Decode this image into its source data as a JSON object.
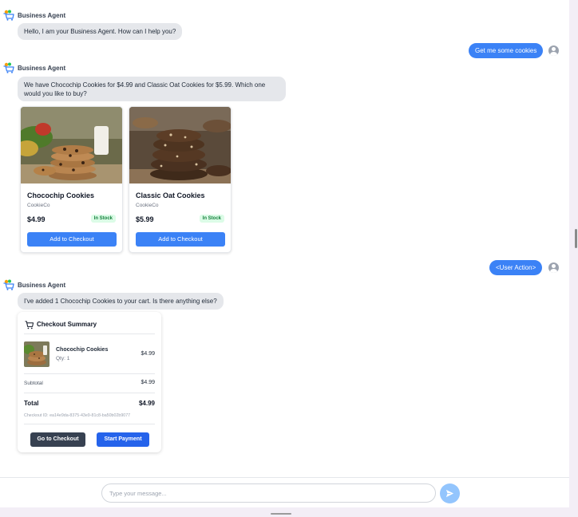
{
  "agent_name": "Business Agent",
  "messages": {
    "greeting": "Hello, I am your Business Agent. How can I help you?",
    "user_request": "Get me some cookies",
    "offer": "We have Chocochip Cookies for $4.99 and Classic Oat Cookies for $5.99. Which one would you like to buy?",
    "user_action": "<User Action>",
    "confirmation": "I've added 1 Chocochip Cookies to your cart. Is there anything else?"
  },
  "products": [
    {
      "name": "Chocochip Cookies",
      "brand": "CookieCo",
      "price": "$4.99",
      "stock": "In Stock",
      "button": "Add to Checkout"
    },
    {
      "name": "Classic Oat Cookies",
      "brand": "CookieCo",
      "price": "$5.99",
      "stock": "In Stock",
      "button": "Add to Checkout"
    }
  ],
  "checkout": {
    "title": "Checkout Summary",
    "item_name": "Chocochip Cookies",
    "item_qty": "Qty: 1",
    "item_price": "$4.99",
    "subtotal_label": "Subtotal",
    "subtotal_value": "$4.99",
    "total_label": "Total",
    "total_value": "$4.99",
    "checkout_id": "Checkout ID: ea14e9da-8375-43e9-81c8-ba50b02b9077",
    "go_button": "Go to Checkout",
    "pay_button": "Start Payment"
  },
  "input": {
    "placeholder": "Type your message..."
  },
  "icons": {
    "agent": "shopping-cart-agent-icon",
    "user": "user-avatar-icon",
    "cart": "cart-icon",
    "send": "send-icon"
  },
  "colors": {
    "primary": "#3b82f6",
    "agent_bubble": "#e5e7eb",
    "stock_green": "#15803d",
    "dark_button": "#374151"
  }
}
